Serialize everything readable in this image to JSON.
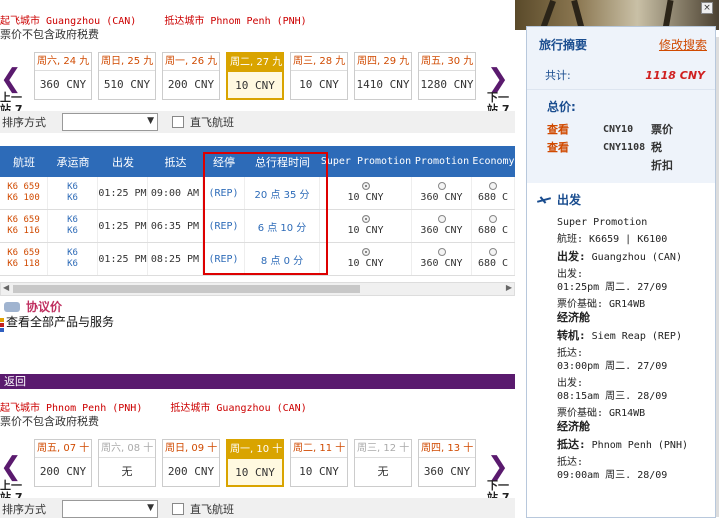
{
  "outbound": {
    "from_label": "起飞城市 Guangzhou (CAN)",
    "to_label": "抵达城市 Phnom Penh (PNH)",
    "tax_note": "票价不包含政府税费",
    "prev_label": "上一站 7",
    "next_label": "下一站 7",
    "dates": [
      {
        "day": "周六, 24 九",
        "price": "360 CNY",
        "state": "normal"
      },
      {
        "day": "周日, 25 九",
        "price": "510 CNY",
        "state": "normal"
      },
      {
        "day": "周一, 26 九",
        "price": "200 CNY",
        "state": "normal"
      },
      {
        "day": "周二, 27 九",
        "price": "10 CNY",
        "state": "selected"
      },
      {
        "day": "周三, 28 九",
        "price": "10 CNY",
        "state": "normal"
      },
      {
        "day": "周四, 29 九",
        "price": "1410 CNY",
        "state": "normal"
      },
      {
        "day": "周五, 30 九",
        "price": "1280 CNY",
        "state": "normal"
      }
    ],
    "sort_label": "排序方式",
    "sort_value": "",
    "direct_label": "直飞航班"
  },
  "table": {
    "headers": [
      "航班",
      "承运商",
      "出发",
      "抵达",
      "经停",
      "总行程时间",
      "Super Promotion",
      "Promotion",
      "Economy"
    ],
    "rows": [
      {
        "flight1": "K6 659",
        "flight2": "K6 100",
        "car1": "K6",
        "car2": "K6",
        "dep": "01:25 PM",
        "arr": "09:00 AM",
        "stops": "(REP)",
        "dur": "20 点 35 分",
        "super": "10 CNY",
        "promo": "360 CNY",
        "eco": "680 C"
      },
      {
        "flight1": "K6 659",
        "flight2": "K6 116",
        "car1": "K6",
        "car2": "K6",
        "dep": "01:25 PM",
        "arr": "06:35 PM",
        "stops": "(REP)",
        "dur": "6 点 10 分",
        "super": "10 CNY",
        "promo": "360 CNY",
        "eco": "680 C"
      },
      {
        "flight1": "K6 659",
        "flight2": "K6 118",
        "car1": "K6",
        "car2": "K6",
        "dep": "01:25 PM",
        "arr": "08:25 PM",
        "stops": "(REP)",
        "dur": "8 点 0 分",
        "super": "10 CNY",
        "promo": "360 CNY",
        "eco": "680 C"
      }
    ]
  },
  "agreement": {
    "title": "协议价",
    "notice": "查看全部产品与服务"
  },
  "return_bar": "返回",
  "inbound": {
    "from_label": "起飞城市 Phnom Penh (PNH)",
    "to_label": "抵达城市 Guangzhou (CAN)",
    "tax_note": "票价不包含政府税费",
    "prev_label": "上一站 7",
    "next_label": "下一站 7",
    "dates": [
      {
        "day": "周五, 07 十",
        "price": "200 CNY",
        "state": "normal"
      },
      {
        "day": "周六, 08 十",
        "price": "无",
        "state": "disabled"
      },
      {
        "day": "周日, 09 十",
        "price": "200 CNY",
        "state": "normal"
      },
      {
        "day": "周一, 10 十",
        "price": "10 CNY",
        "state": "selected"
      },
      {
        "day": "周二, 11 十",
        "price": "10 CNY",
        "state": "normal"
      },
      {
        "day": "周三, 12 十",
        "price": "无",
        "state": "disabled"
      },
      {
        "day": "周四, 13 十",
        "price": "360 CNY",
        "state": "normal"
      }
    ],
    "sort_label": "排序方式",
    "direct_label": "直飞航班"
  },
  "sidebar": {
    "title": "旅行摘要",
    "edit": "修改搜索",
    "total_label": "共计:",
    "total_value": "1118 CNY",
    "price_label": "总价:",
    "price_lines": [
      {
        "link": "查看",
        "amount": "CNY10",
        "desc": "票价"
      },
      {
        "link": "查看",
        "amount": "CNY1108",
        "desc": "税"
      }
    ],
    "discount": "折扣",
    "departure_title": "出发",
    "fare_class": "Super Promotion",
    "flight": "航班: K6659 | K6100",
    "dep_label": "出发:",
    "dep_city": "Guangzhou (CAN)",
    "dep_time_label": "出发:",
    "dep_time": "01:25pm 周二. 27/09",
    "fare_basis1": "票价基础: GR14WB",
    "cabin1": "经济舱",
    "transfer_label": "转机:",
    "transfer_city": "Siem Reap (REP)",
    "arr1_label": "抵达:",
    "arr1_time": "03:00pm 周二. 27/09",
    "dep2_label": "出发:",
    "dep2_time": "08:15am 周三. 28/09",
    "fare_basis2": "票价基础: GR14WB",
    "cabin2": "经济舱",
    "arr_label": "抵达:",
    "arr_city": "Phnom Penh (PNH)",
    "arr2_label": "抵达:",
    "arr2_time": "09:00am 周三. 28/09"
  }
}
